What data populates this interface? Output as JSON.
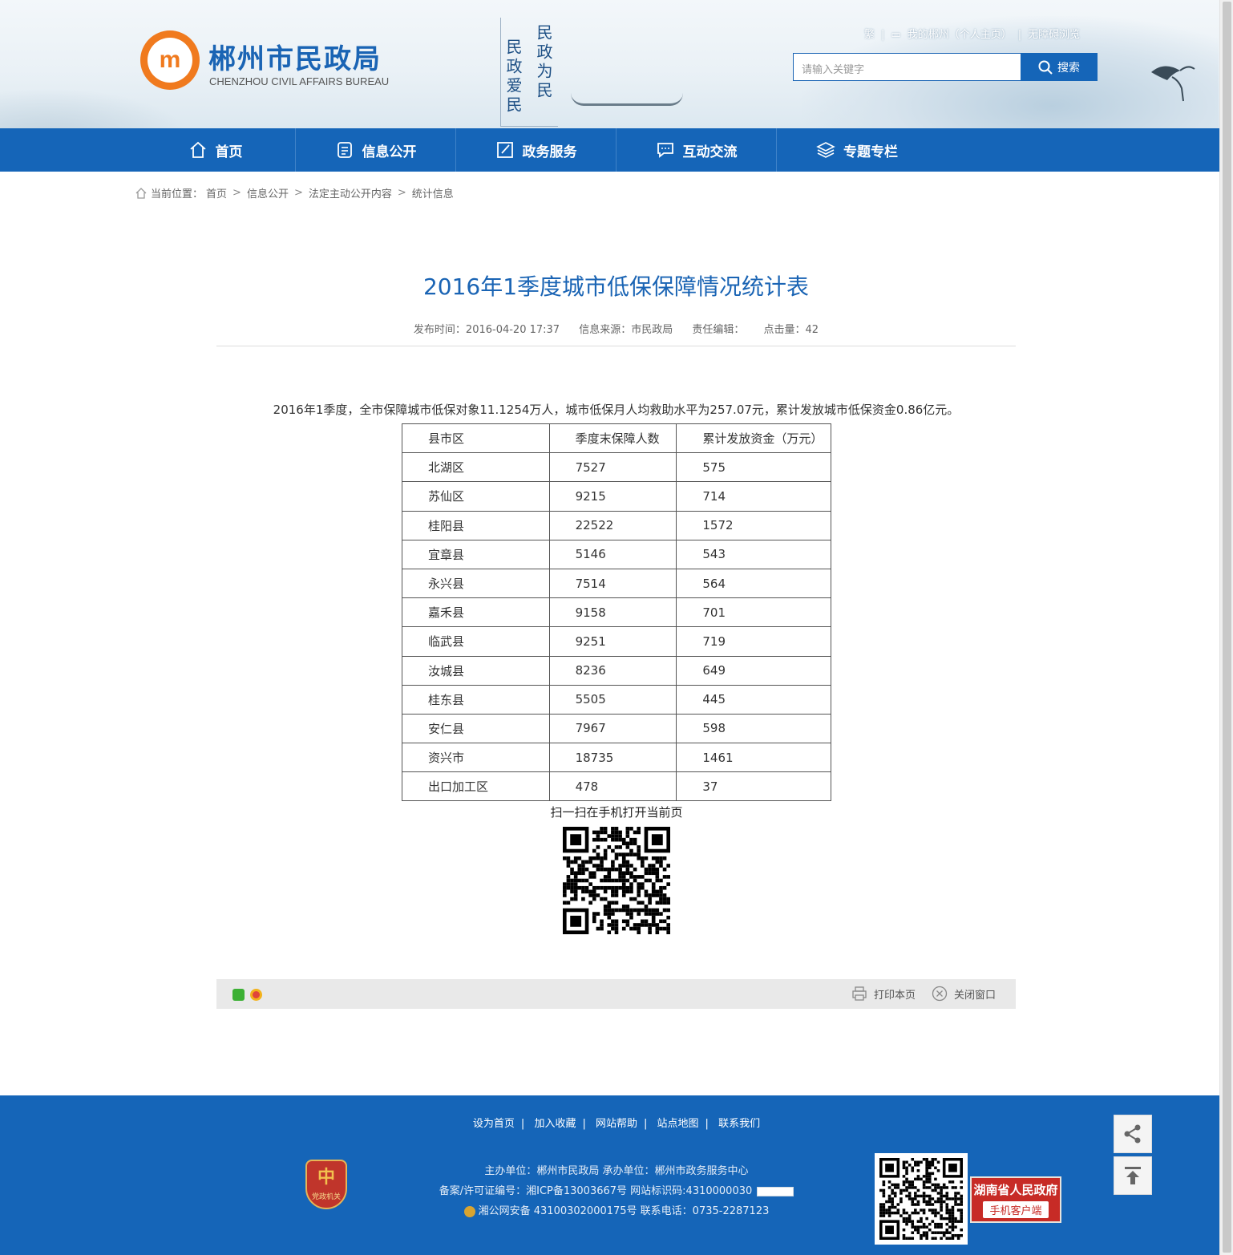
{
  "header": {
    "logo_glyph": "m",
    "site_title": "郴州市民政局",
    "site_subtitle": "CHENZHOU CIVIL AFFAIRS BUREAU",
    "slogan": [
      "民政为民",
      "民政爱民"
    ],
    "top_links": [
      "繁",
      "|",
      "我的郴州（个人主页）",
      "|",
      "无障碍浏览"
    ],
    "search_placeholder": "请输入关键字",
    "search_button": "搜索"
  },
  "nav": [
    "首页",
    "信息公开",
    "政务服务",
    "互动交流",
    "专题专栏"
  ],
  "breadcrumb": {
    "label": "当前位置：",
    "items": [
      "首页",
      "信息公开",
      "法定主动公开内容",
      "统计信息"
    ],
    "separator": ">"
  },
  "article": {
    "title": "2016年1季度城市低保保障情况统计表",
    "publish_time": "发布时间：2016-04-20 17:37",
    "source": "信息来源：市民政局",
    "editor": "责任编辑：",
    "hits": "点击量：42",
    "intro": "2016年1季度，全市保障城市低保对象11.1254万人，城市低保月人均救助水平为257.07元，累计发放城市低保资金0.86亿元。",
    "table": {
      "headers": [
        "县市区",
        "季度末保障人数",
        "累计发放资金（万元）"
      ],
      "rows": [
        [
          "北湖区",
          "7527",
          "575"
        ],
        [
          "苏仙区",
          "9215",
          "714"
        ],
        [
          "桂阳县",
          "22522",
          "1572"
        ],
        [
          "宜章县",
          "5146",
          "543"
        ],
        [
          "永兴县",
          "7514",
          "564"
        ],
        [
          "嘉禾县",
          "9158",
          "701"
        ],
        [
          "临武县",
          "9251",
          "719"
        ],
        [
          "汝城县",
          "8236",
          "649"
        ],
        [
          "桂东县",
          "5505",
          "445"
        ],
        [
          "安仁县",
          "7967",
          "598"
        ],
        [
          "资兴市",
          "18735",
          "1461"
        ],
        [
          "出口加工区",
          "478",
          "37"
        ]
      ]
    },
    "qr_caption": "扫一扫在手机打开当前页",
    "print_label": "打印本页",
    "close_label": "关闭窗口"
  },
  "footer": {
    "links": [
      "设为首页",
      "加入收藏",
      "网站帮助",
      "站点地图",
      "联系我们"
    ],
    "host": "主办单位：郴州市民政局   承办单位：郴州市政务服务中心",
    "icp": "备案/许可证编号：湘ICP备13003667号    网站标识码:4310000030",
    "police": "湘公网安备 43100302000175号   联系电话：0735-2287123",
    "badge_glyph": "中",
    "badge_text": "党政机关",
    "hunan_title": "湖南省人民政府",
    "hunan_sub": "手机客户端"
  },
  "colors": {
    "primary": "#1565b8",
    "title": "#1a64b4",
    "logo": "#f07a1e"
  }
}
